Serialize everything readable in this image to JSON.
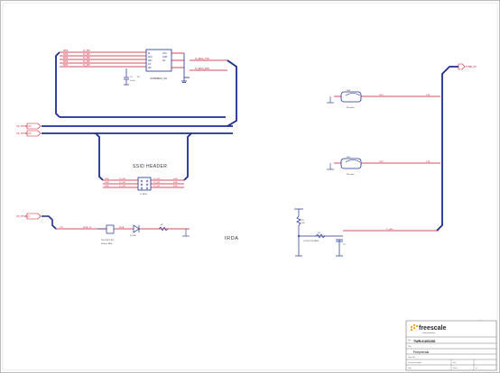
{
  "schematic": {
    "header_label": "SSID HEADER",
    "irda_label": "IRDA",
    "ports": {
      "left_1": "XX_TPSB_XX",
      "left_2": "XX_TPSB_XX",
      "left_3": "XX_TPSB_X",
      "right_top": "TPSB_XX"
    },
    "ic_part": "AT45DB041_SO",
    "net_label_top": "IO_IRDA_TXD"
  },
  "title_block": {
    "brand": "freescale",
    "brand_sub": "semiconductor",
    "product": "TWR-K40X256",
    "page_title": "Peripherals"
  },
  "colors": {
    "wire": "#1f2f8f",
    "signal": "#c8142a",
    "border": "#999999"
  }
}
